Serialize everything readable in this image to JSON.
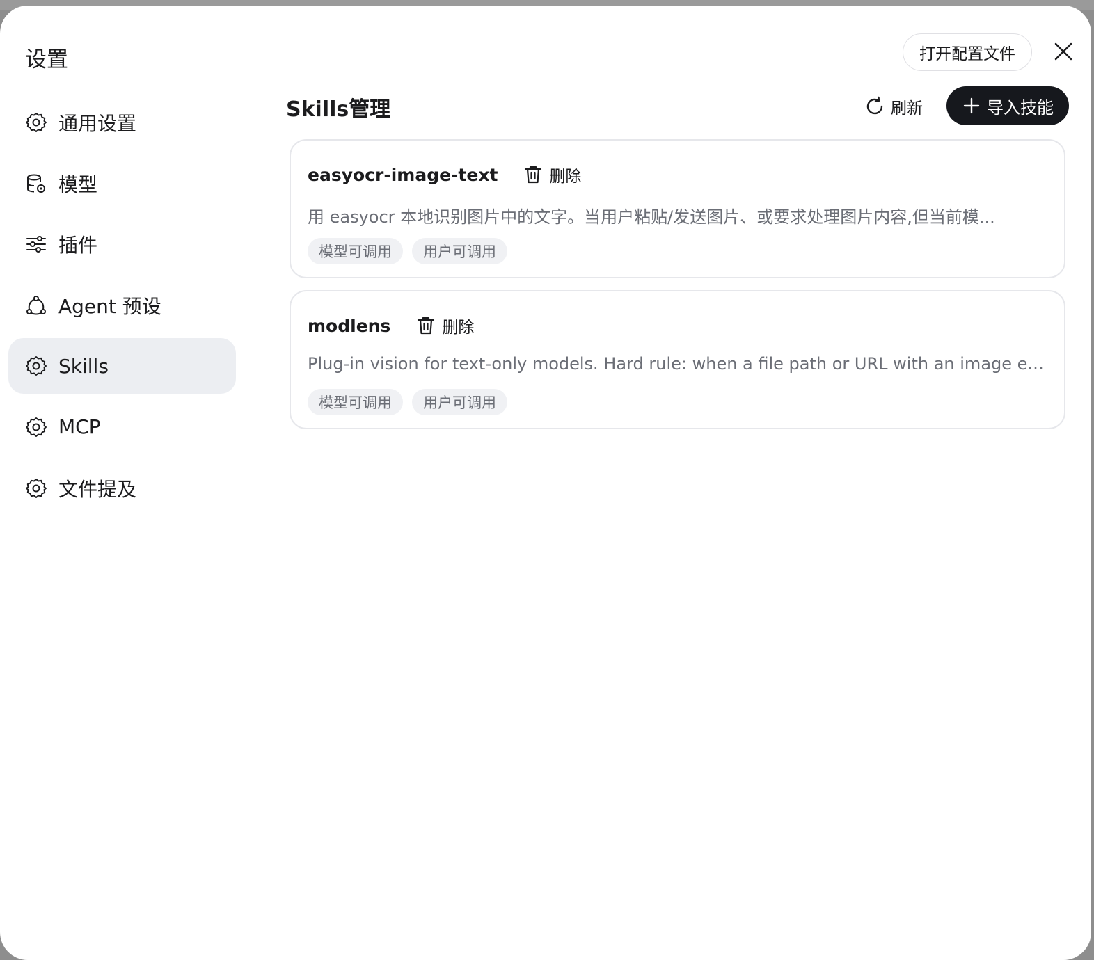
{
  "dialog": {
    "title": "设置",
    "open_config_label": "打开配置文件",
    "close_icon": "close-icon"
  },
  "sidebar": {
    "items": [
      {
        "label": "通用设置",
        "icon": "gear-icon",
        "active": false
      },
      {
        "label": "模型",
        "icon": "database-gear-icon",
        "active": false
      },
      {
        "label": "插件",
        "icon": "sliders-icon",
        "active": false
      },
      {
        "label": "Agent 预设",
        "icon": "agent-nodes-icon",
        "active": false
      },
      {
        "label": "Skills",
        "icon": "gear-icon",
        "active": true
      },
      {
        "label": "MCP",
        "icon": "gear-icon",
        "active": false
      },
      {
        "label": "文件提及",
        "icon": "gear-icon",
        "active": false
      }
    ]
  },
  "main": {
    "title": "Skills管理",
    "refresh_label": "刷新",
    "import_label": "导入技能",
    "skills": [
      {
        "name": "easyocr-image-text",
        "delete_label": "删除",
        "description": "用 easyocr 本地识别图片中的文字。当用户粘贴/发送图片、或要求处理图片内容,但当前模...",
        "tags": [
          "模型可调用",
          "用户可调用"
        ]
      },
      {
        "name": "modlens",
        "delete_label": "删除",
        "description": "Plug-in vision for text-only models. Hard rule: when a file path or URL with an image extens...",
        "tags": [
          "模型可调用",
          "用户可调用"
        ]
      }
    ]
  }
}
